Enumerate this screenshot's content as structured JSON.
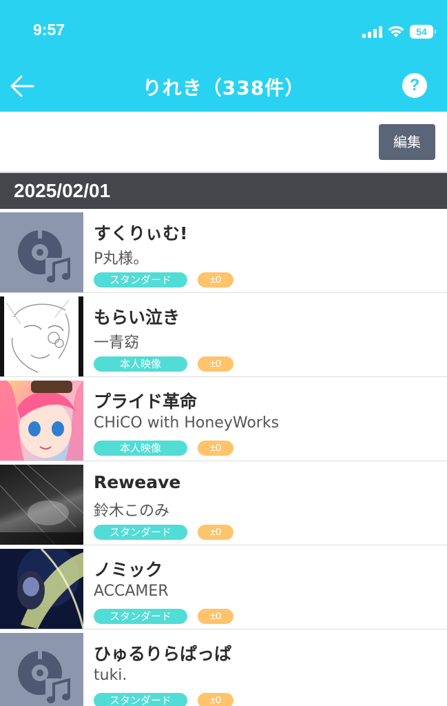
{
  "status_bar": {
    "time": "9:57",
    "battery": "54"
  },
  "header": {
    "title": "りれき（338件）",
    "help_label": "?"
  },
  "toolbar": {
    "edit_label": "編集"
  },
  "history": {
    "date": "2025/02/01",
    "items": [
      {
        "title": "すくりぃむ!",
        "artist": "P丸様。",
        "kind": "スタンダード",
        "score": "±0",
        "thumbnail": "disc-music-icon"
      },
      {
        "title": "もらい泣き",
        "artist": "一青窈",
        "kind": "本人映像",
        "score": "±0",
        "thumbnail": "line-drawing-face"
      },
      {
        "title": "プライド革命",
        "artist": "CHiCO with HoneyWorks",
        "kind": "本人映像",
        "score": "±0",
        "thumbnail": "anime-pink-hair"
      },
      {
        "title": "Reweave",
        "artist": "鈴木このみ",
        "kind": "スタンダード",
        "score": "±0",
        "thumbnail": "dark-abstract"
      },
      {
        "title": "ノミック",
        "artist": "ACCAMER",
        "kind": "スタンダード",
        "score": "±0",
        "thumbnail": "anime-dark-glow"
      },
      {
        "title": "ひゅるりらぱっぱ",
        "artist": "tuki.",
        "kind": "スタンダード",
        "score": "±0",
        "thumbnail": "disc-music-icon"
      }
    ]
  },
  "colors": {
    "accent": "#2ad2f2",
    "edit_button": "#5a6577",
    "date_header": "#44464b",
    "tag_kind": "#52dcd6",
    "tag_score": "#ffc36b",
    "disc_bg": "#8c96ad",
    "disc_icon": "#4f5872"
  }
}
